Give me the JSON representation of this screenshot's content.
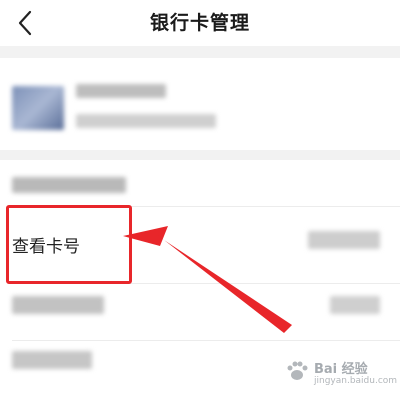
{
  "header": {
    "title": "银行卡管理",
    "back_icon": "chevron-left-icon"
  },
  "rows": [
    {
      "label": "查看卡号",
      "highlighted": true
    }
  ],
  "colors": {
    "accent": "#e8262a",
    "background": "#f2f2f2",
    "text": "#222222"
  },
  "watermark": {
    "brand": "Bai 经验",
    "url": "jingyan.baidu.com"
  }
}
